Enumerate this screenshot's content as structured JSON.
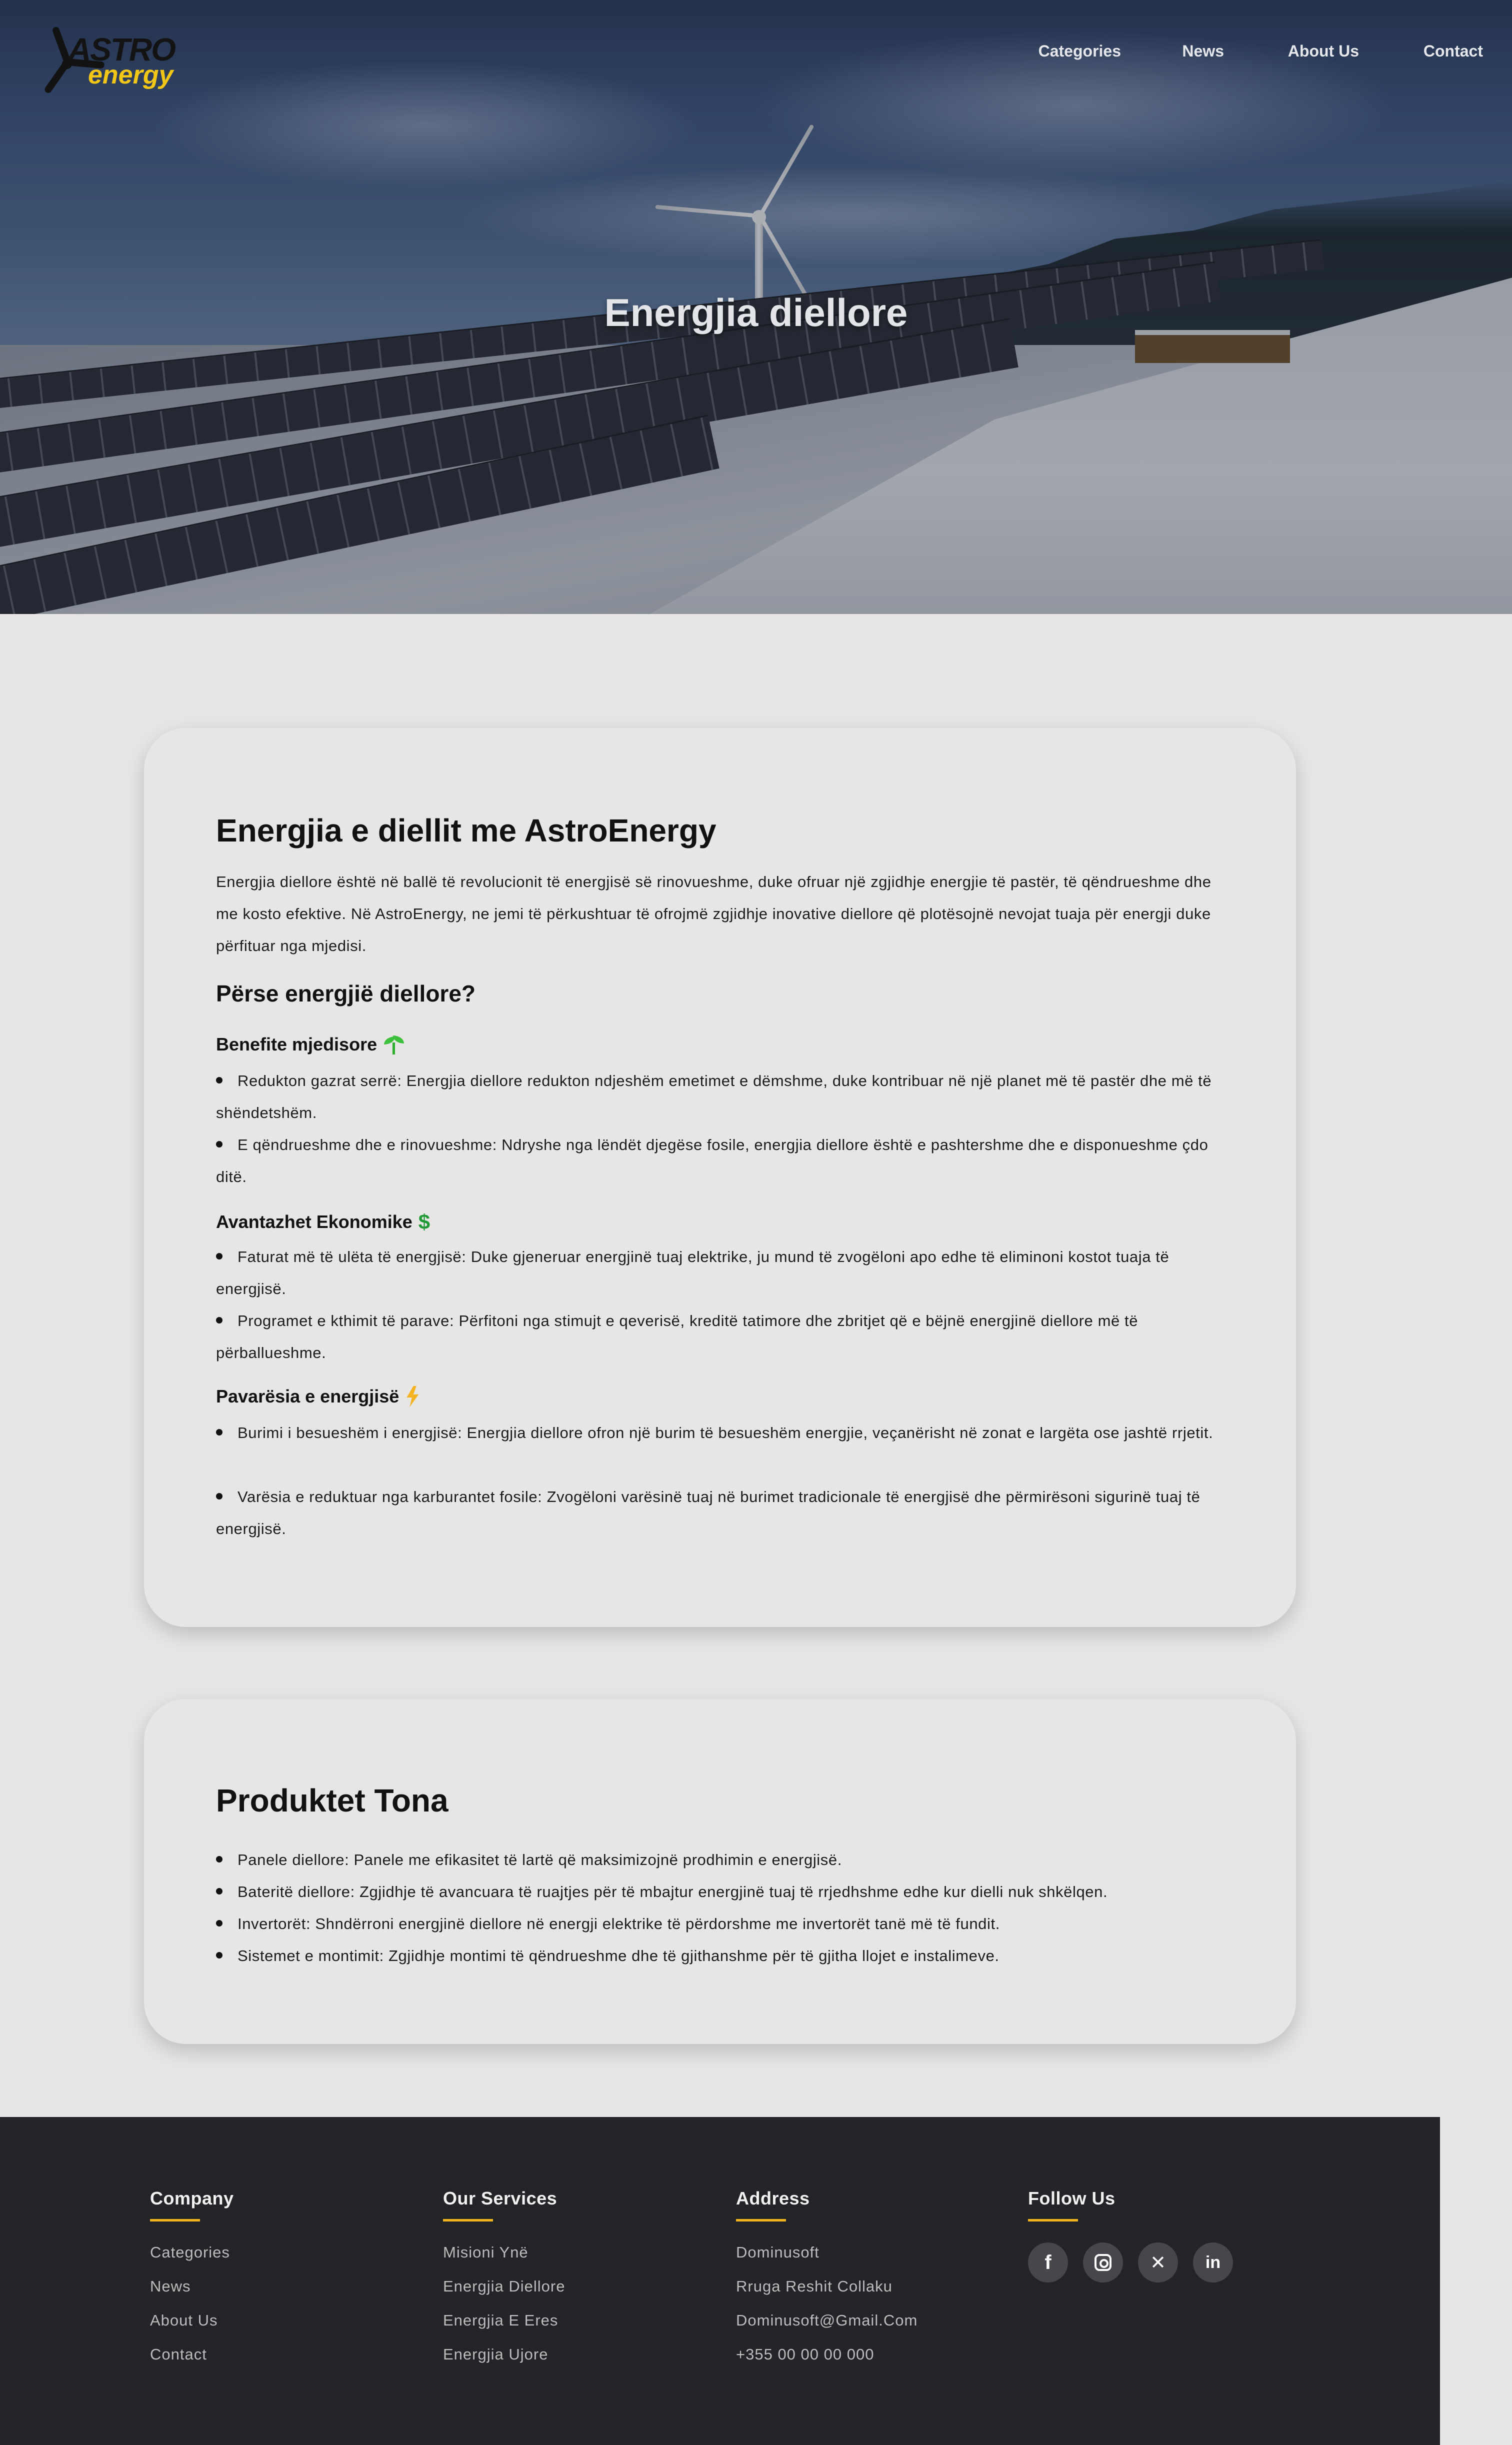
{
  "header": {
    "logo_text_primary": "ASTRO",
    "logo_text_secondary": "energy",
    "nav": [
      "Categories",
      "News",
      "About Us",
      "Contact"
    ],
    "hero_title": "Energjia diellore"
  },
  "intro_card": {
    "title": "Energjia e diellit me AstroEnergy",
    "lead": "Energjia diellore është në ballë të revolucionit të energjisë së rinovueshme, duke ofruar një zgjidhje energjie të pastër, të qëndrueshme dhe me kosto efektive. Në AstroEnergy, ne jemi të përkushtuar të ofrojmë zgjidhje inovative diellore që plotësojnë nevojat tuaja për energji duke përfituar nga mjedisi.",
    "why_title": "Përse energjië diellore?",
    "sections": [
      {
        "heading": "Benefite mjedisore",
        "icon": "sprout-icon",
        "bullets": [
          "Redukton gazrat serrë: Energjia diellore redukton ndjeshëm emetimet e dëmshme, duke kontribuar në një planet më të pastër dhe më të shëndetshëm.",
          "E qëndrueshme dhe e rinovueshme: Ndryshe nga lëndët djegëse fosile, energjia diellore është e pashtershme dhe e disponueshme çdo ditë."
        ]
      },
      {
        "heading": "Avantazhet Ekonomike",
        "icon": "dollar-icon",
        "bullets": [
          "Faturat më të ulëta të energjisë: Duke gjeneruar energjinë tuaj elektrike, ju mund të zvogëloni apo edhe të eliminoni kostot tuaja të energjisë.",
          "Programet e kthimit të parave: Përfitoni nga stimujt e qeverisë, kreditë tatimore dhe zbritjet që e bëjnë energjinë diellore më të përballueshme."
        ]
      },
      {
        "heading": "Pavarësia e energjisë",
        "icon": "lightning-icon",
        "bullets": [
          "Burimi i besueshëm i energjisë: Energjia diellore ofron një burim të besueshëm energjie, veçanërisht në zonat e largëta ose jashtë rrjetit.",
          "Varësia e reduktuar nga karburantet fosile: Zvogëloni varësinë tuaj në burimet tradicionale të energjisë dhe përmirësoni sigurinë tuaj të energjisë."
        ]
      }
    ]
  },
  "products_card": {
    "title": "Produktet Tona",
    "bullets": [
      "Panele diellore: Panele me efikasitet të lartë që maksimizojnë prodhimin e energjisë.",
      "Bateritë diellore: Zgjidhje të avancuara të ruajtjes për të mbajtur energjinë tuaj të rrjedhshme edhe kur dielli nuk shkëlqen.",
      "Invertorët: Shndërroni energjinë diellore në energji elektrike të përdorshme me invertorët tanë më të fundit.",
      "Sistemet e montimit: Zgjidhje montimi të qëndrueshme dhe të gjithanshme për të gjitha llojet e instalimeve."
    ]
  },
  "footer": {
    "company": {
      "title": "Company",
      "items": [
        "Categories",
        "News",
        "About Us",
        "Contact"
      ]
    },
    "services": {
      "title": "Our Services",
      "items": [
        "Misioni Ynë",
        "Energjia Diellore",
        "Energjia E Eres",
        "Energjia Ujore"
      ]
    },
    "address": {
      "title": "Address",
      "items": [
        "Dominusoft",
        "Rruga Reshit Collaku",
        "Dominusoft@Gmail.Com",
        "+355 00 00 00 000"
      ]
    },
    "follow": {
      "title": "Follow Us",
      "icons": [
        "facebook-icon",
        "instagram-icon",
        "x-icon",
        "linkedin-icon"
      ]
    }
  },
  "colors": {
    "accent": "#f1b41e",
    "logo_yellow": "#f2c614",
    "footer_bg": "#232427",
    "page_bg": "#e8e6e4"
  }
}
